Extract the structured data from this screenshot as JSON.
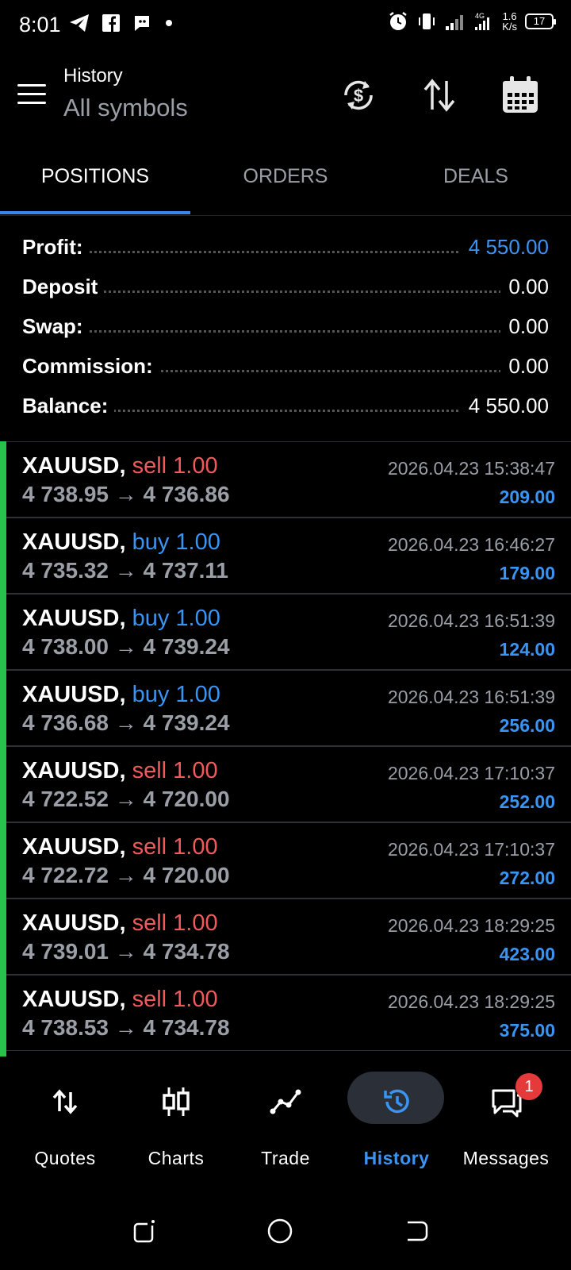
{
  "status_bar": {
    "time": "8:01",
    "speed_top": "1.6",
    "speed_bottom": "K/s",
    "network": "4G",
    "battery": "17"
  },
  "header": {
    "title": "History",
    "subtitle": "All symbols"
  },
  "tabs": [
    {
      "label": "POSITIONS",
      "active": true
    },
    {
      "label": "ORDERS",
      "active": false
    },
    {
      "label": "DEALS",
      "active": false
    }
  ],
  "summary": {
    "profit_label": "Profit:",
    "profit_value": "4 550.00",
    "deposit_label": "Deposit",
    "deposit_value": "0.00",
    "swap_label": "Swap:",
    "swap_value": "0.00",
    "commission_label": "Commission:",
    "commission_value": "0.00",
    "balance_label": "Balance:",
    "balance_value": "4 550.00"
  },
  "positions": [
    {
      "symbol": "XAUUSD,",
      "side": "sell 1.00",
      "prices": "4 738.95 → 4 736.86",
      "date": "2026.04.23 15:38:47",
      "profit": "209.00"
    },
    {
      "symbol": "XAUUSD,",
      "side": "buy 1.00",
      "prices": "4 735.32 → 4 737.11",
      "date": "2026.04.23 16:46:27",
      "profit": "179.00"
    },
    {
      "symbol": "XAUUSD,",
      "side": "buy 1.00",
      "prices": "4 738.00 → 4 739.24",
      "date": "2026.04.23 16:51:39",
      "profit": "124.00"
    },
    {
      "symbol": "XAUUSD,",
      "side": "buy 1.00",
      "prices": "4 736.68 → 4 739.24",
      "date": "2026.04.23 16:51:39",
      "profit": "256.00"
    },
    {
      "symbol": "XAUUSD,",
      "side": "sell 1.00",
      "prices": "4 722.52 → 4 720.00",
      "date": "2026.04.23 17:10:37",
      "profit": "252.00"
    },
    {
      "symbol": "XAUUSD,",
      "side": "sell 1.00",
      "prices": "4 722.72 → 4 720.00",
      "date": "2026.04.23 17:10:37",
      "profit": "272.00"
    },
    {
      "symbol": "XAUUSD,",
      "side": "sell 1.00",
      "prices": "4 739.01 → 4 734.78",
      "date": "2026.04.23 18:29:25",
      "profit": "423.00"
    },
    {
      "symbol": "XAUUSD,",
      "side": "sell 1.00",
      "prices": "4 738.53 → 4 734.78",
      "date": "2026.04.23 18:29:25",
      "profit": "375.00"
    }
  ],
  "bottom_nav": {
    "quotes": "Quotes",
    "charts": "Charts",
    "trade": "Trade",
    "history": "History",
    "messages": "Messages",
    "messages_badge": "1"
  },
  "colors": {
    "accent_blue": "#3a94f3",
    "sell_red": "#f05a5a",
    "accent_green": "#27c24c"
  }
}
